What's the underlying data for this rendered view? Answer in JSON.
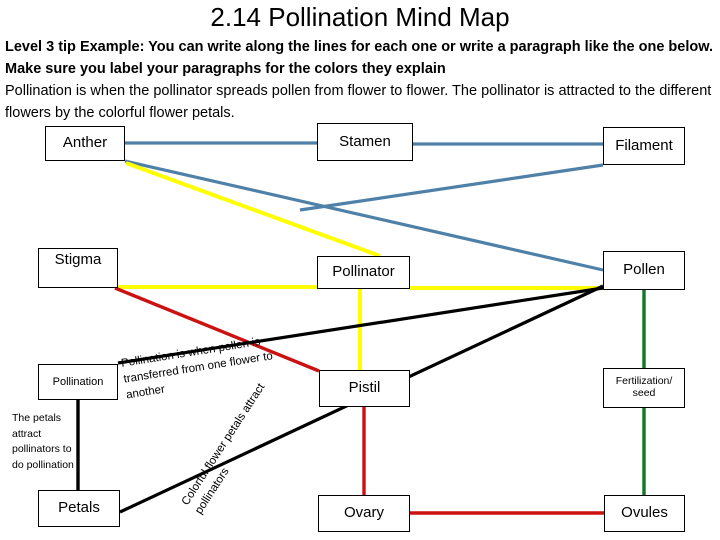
{
  "header": {
    "title": "2.14 Pollination Mind Map",
    "intro_bold": "Level 3 tip Example: You can write along the lines for each one or write a paragraph like the one below.  Make sure you label your paragraphs for the colors they explain",
    "intro_normal": "Pollination is when the pollinator spreads pollen from flower to flower.  The pollinator is attracted to the different flowers by the colorful flower petals."
  },
  "nodes": {
    "anther": "Anther",
    "stamen": "Stamen",
    "filament": "Filament",
    "stigma": "Stigma",
    "pollinator": "Pollinator",
    "pollen": "Pollen",
    "pollination": "Pollination",
    "pistil": "Pistil",
    "fertilization_seed": "Fertilization/ seed",
    "petals": "Petals",
    "ovary": "Ovary",
    "ovules": "Ovules"
  },
  "notes": {
    "petals_note": "The petals attract pollinators to do pollination",
    "pollination_definition": "Pollination is when pollen is transferred from one flower to another",
    "colorful_flower": "Colorful flower petals attract pollinators"
  },
  "colors": {
    "blue": "#4f81a8",
    "yellow": "#ffff00",
    "red": "#cc1111",
    "green": "#117722",
    "black": "#000000",
    "box_border": "#000000",
    "background": "#ffffff"
  },
  "connectors": [
    {
      "name": "anther-stamen",
      "color": "#4f81a8",
      "from": "anther",
      "to": "stamen"
    },
    {
      "name": "stamen-filament",
      "color": "#4f81a8",
      "from": "stamen",
      "to": "filament"
    },
    {
      "name": "anther-crossing",
      "color": "#4f81a8",
      "from": "anther",
      "to": "pollen"
    },
    {
      "name": "filament-pollen",
      "color": "#4f81a8",
      "from": "filament",
      "to": "pollen"
    },
    {
      "name": "anther-pollinator",
      "color": "#ffff00",
      "from": "anther",
      "to": "pollinator"
    },
    {
      "name": "stigma-pollinator",
      "color": "#ffff00",
      "from": "stigma",
      "to": "pollinator"
    },
    {
      "name": "pollinator-pollen",
      "color": "#ffff00",
      "from": "pollinator",
      "to": "pollen"
    },
    {
      "name": "pollinator-pistil",
      "color": "#ffff00",
      "from": "pollinator",
      "to": "pistil"
    },
    {
      "name": "stigma-pistil",
      "color": "#cc1111",
      "from": "stigma",
      "to": "pistil"
    },
    {
      "name": "pistil-ovary",
      "color": "#cc1111",
      "from": "pistil",
      "to": "ovary"
    },
    {
      "name": "ovary-ovules",
      "color": "#cc1111",
      "from": "ovary",
      "to": "ovules"
    },
    {
      "name": "pollen-fertilization",
      "color": "#117722",
      "from": "pollen",
      "to": "fertilization_seed"
    },
    {
      "name": "fertilization-ovules",
      "color": "#117722",
      "from": "fertilization_seed",
      "to": "ovules"
    },
    {
      "name": "pollination-pollen",
      "color": "#000000",
      "from": "pollination",
      "to": "pollen"
    },
    {
      "name": "petals-pollen",
      "color": "#000000",
      "from": "petals",
      "to": "pollen"
    },
    {
      "name": "pollination-petals",
      "color": "#000000",
      "from": "pollination",
      "to": "petals"
    }
  ]
}
